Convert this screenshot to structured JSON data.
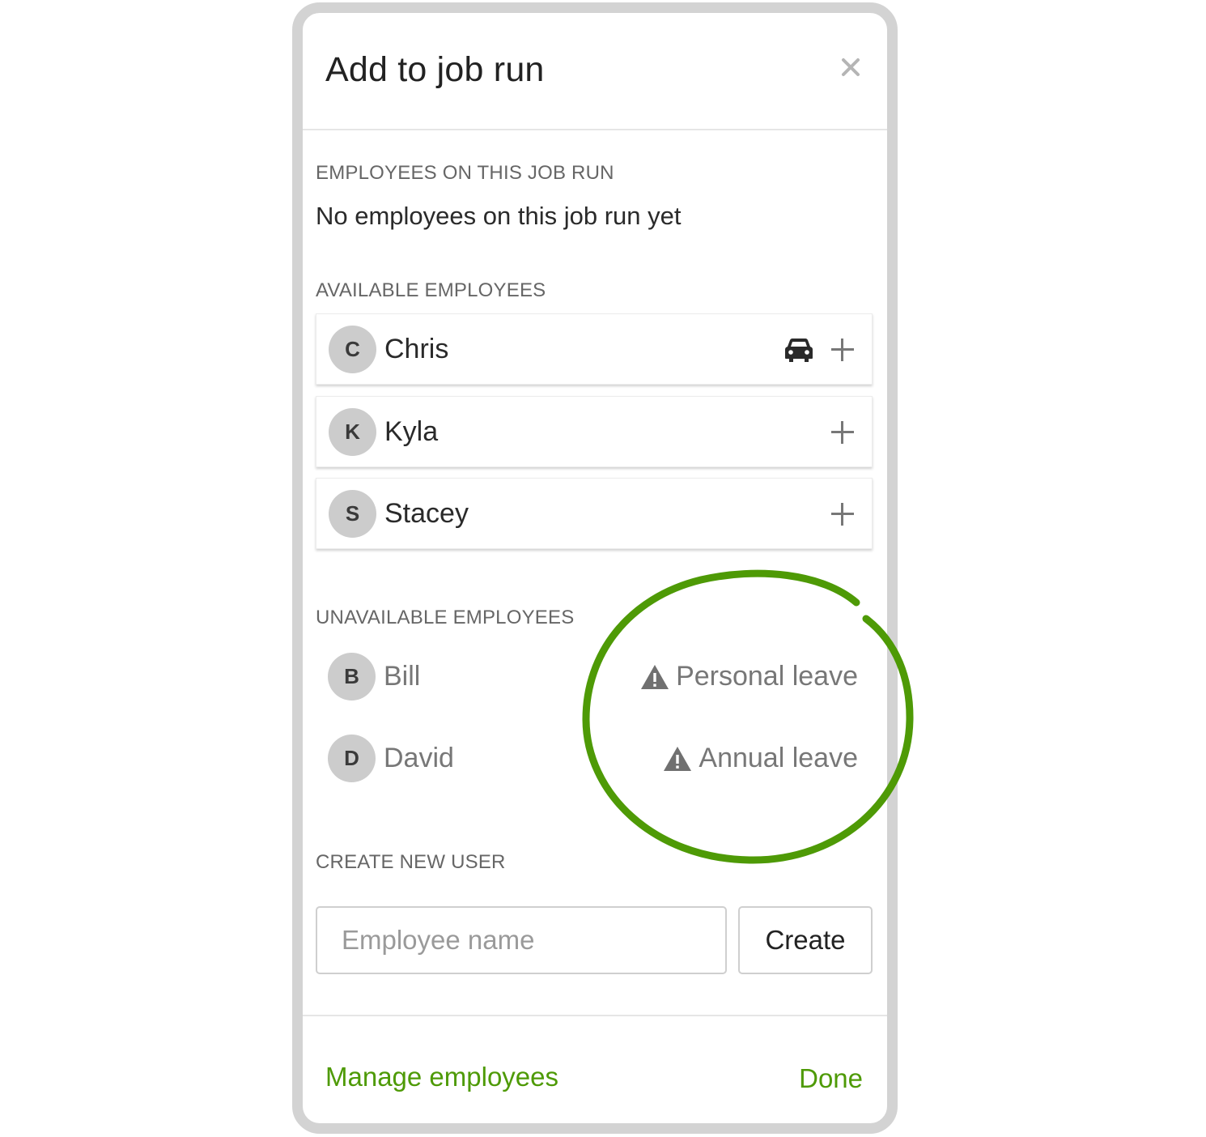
{
  "modal": {
    "title": "Add to job run"
  },
  "sections": {
    "on_job_run": {
      "label": "EMPLOYEES ON THIS JOB RUN",
      "empty_text": "No employees on this job run yet"
    },
    "available": {
      "label": "AVAILABLE EMPLOYEES",
      "employees": [
        {
          "initial": "C",
          "name": "Chris",
          "has_vehicle": true
        },
        {
          "initial": "K",
          "name": "Kyla",
          "has_vehicle": false
        },
        {
          "initial": "S",
          "name": "Stacey",
          "has_vehicle": false
        }
      ]
    },
    "unavailable": {
      "label": "UNAVAILABLE EMPLOYEES",
      "employees": [
        {
          "initial": "B",
          "name": "Bill",
          "reason": "Personal leave"
        },
        {
          "initial": "D",
          "name": "David",
          "reason": "Annual leave"
        }
      ]
    },
    "create_user": {
      "label": "CREATE NEW USER",
      "input_placeholder": "Employee name",
      "input_value": "",
      "create_label": "Create"
    }
  },
  "footer": {
    "manage_label": "Manage employees",
    "done_label": "Done"
  },
  "colors": {
    "accent": "#4e9a06",
    "highlight_ring": "#4e9a06",
    "avatar_bg": "#cccccc",
    "frame_border": "#d3d3d3"
  },
  "icons": {
    "close": "close-icon",
    "add": "plus-icon",
    "vehicle": "car-icon",
    "warning": "warning-icon"
  }
}
